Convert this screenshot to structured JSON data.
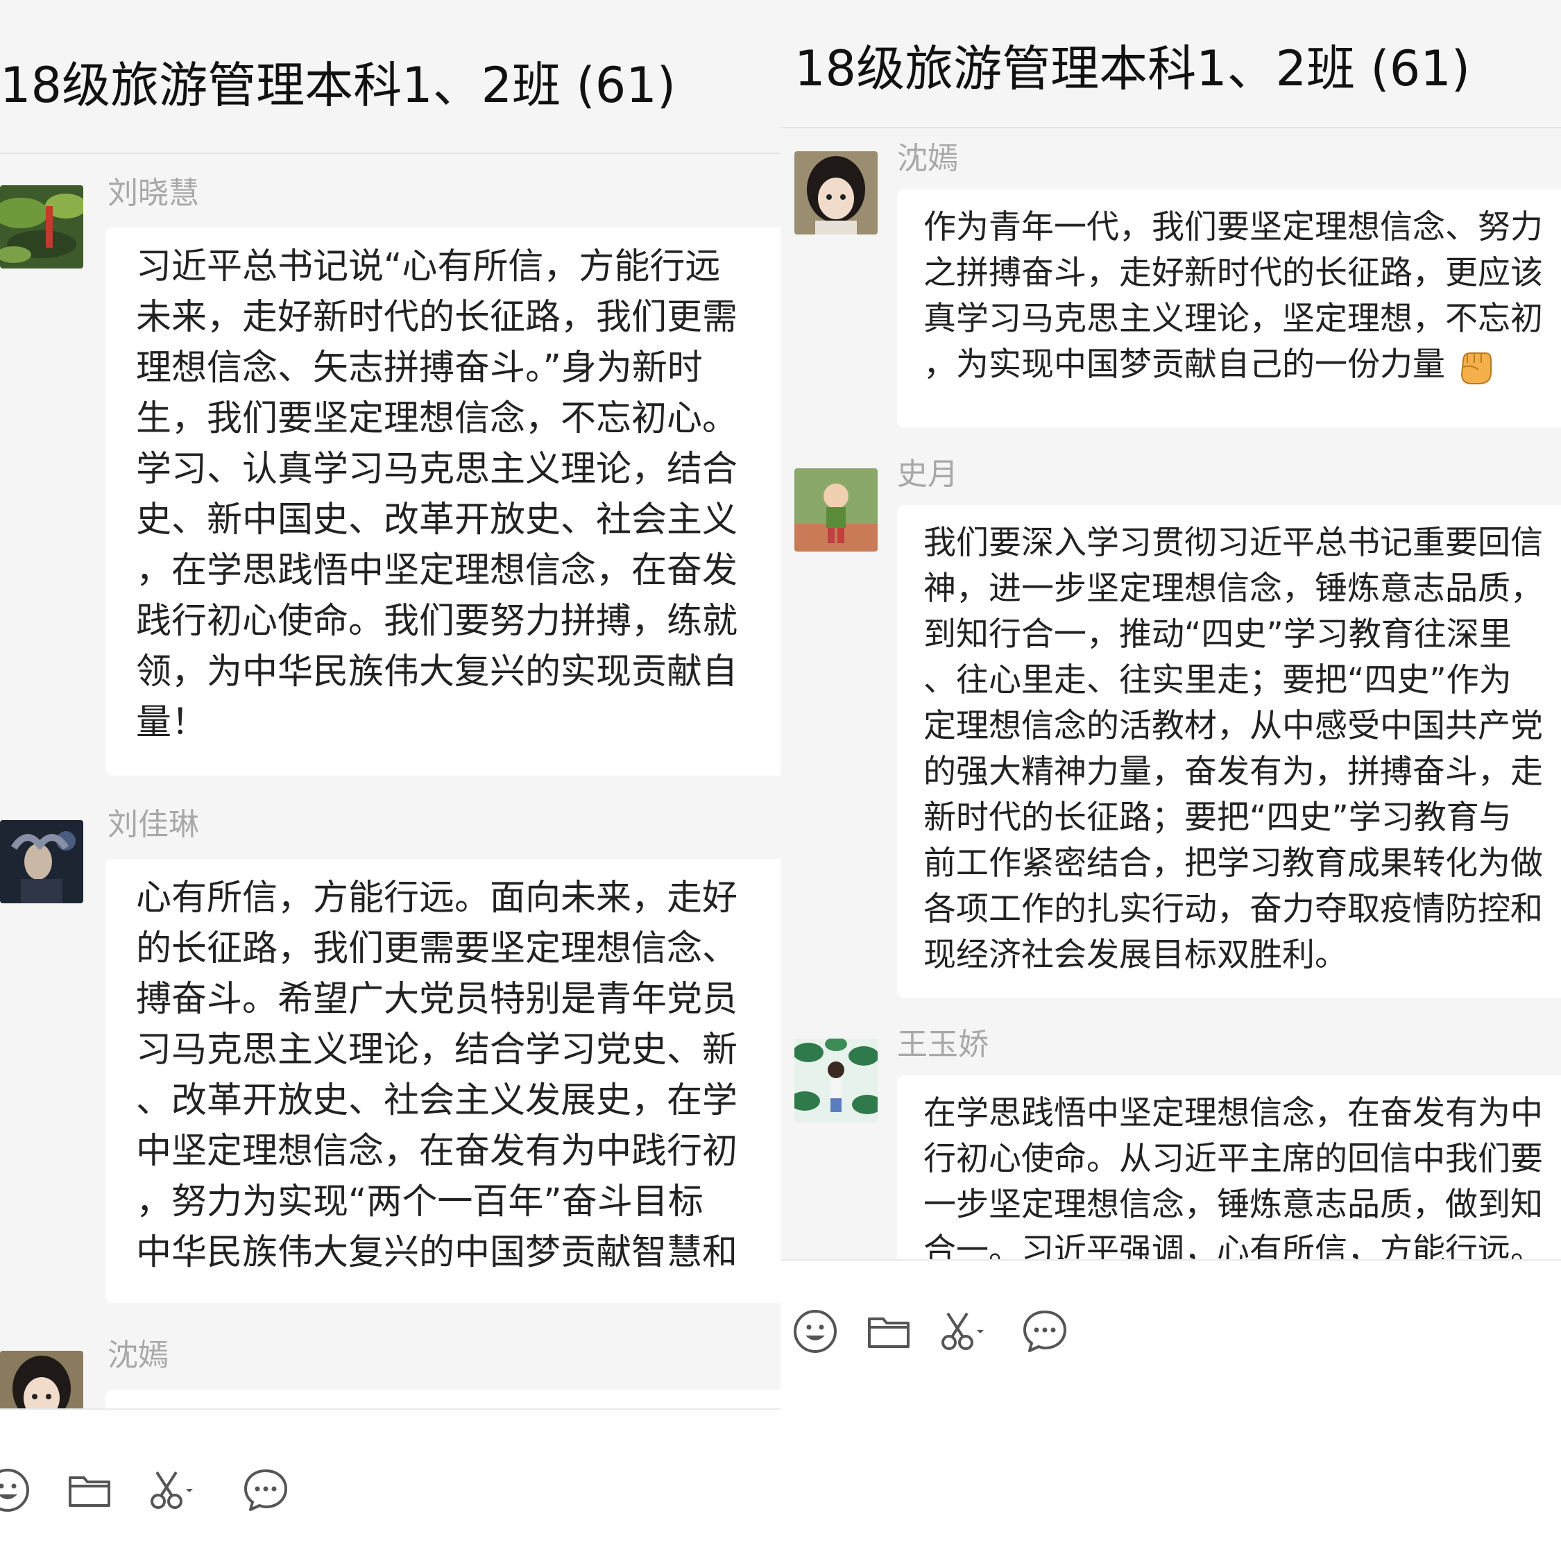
{
  "panels": [
    {
      "title": "18级旅游管理本科1、2班 (61)",
      "messages": [
        {
          "sender": "刘晓慧",
          "text": "习近平总书记说“心有所信，方能行远\n未来，走好新时代的长征路，我们更需\n理想信念、矢志拼搏奋斗。”身为新时\n生，我们要坚定理想信念，不忘初心。\n学习、认真学习马克思主义理论，结合\n史、新中国史、改革开放史、社会主义\n，在学思践悟中坚定理想信念，在奋发\n践行初心使命。我们要努力拼搏，练就\n领，为中华民族伟大复兴的实现贡献自\n量！"
        },
        {
          "sender": "刘佳琳",
          "text": "心有所信，方能行远。面向未来，走好\n的长征路，我们更需要坚定理想信念、\n搏奋斗。希望广大党员特别是青年党员\n习马克思主义理论，结合学习党史、新\n、改革开放史、社会主义发展史，在学\n中坚定理想信念，在奋发有为中践行初\n，努力为实现“两个一百年”奋斗目标\n中华民族伟大复兴的中国梦贡献智慧和"
        },
        {
          "sender": "沈嫣",
          "text": ""
        }
      ]
    },
    {
      "title": "18级旅游管理本科1、2班 (61)",
      "messages": [
        {
          "sender": "沈嫣",
          "text": "作为青年一代，我们要坚定理想信念、努力\n之拼搏奋斗，走好新时代的长征路，更应该\n真学习马克思主义理论，坚定理想，不忘初\n，为实现中国梦贡献自己的一份力量",
          "emoji": "raised-fist-emoji"
        },
        {
          "sender": "史月",
          "text": "我们要深入学习贯彻习近平总书记重要回信\n神，进一步坚定理想信念，锤炼意志品质，\n到知行合一，推动“四史”学习教育往深里\n、往心里走、往实里走；要把“四史”作为\n定理想信念的活教材，从中感受中国共产党\n的强大精神力量，奋发有为，拼搏奋斗，走\n新时代的长征路；要把“四史”学习教育与\n前工作紧密结合，把学习教育成果转化为做\n各项工作的扎实行动，奋力夺取疫情防控和\n现经济社会发展目标双胜利。"
        },
        {
          "sender": "王玉娇",
          "text": "在学思践悟中坚定理想信念，在奋发有为中\n行初心使命。从习近平主席的回信中我们要\n一步坚定理想信念，锤炼意志品质，做到知\n合一。习近平强调，心有所信，方能行远。"
        }
      ]
    }
  ],
  "toolbar": {
    "icons": [
      "emoji-icon",
      "folder-icon",
      "scissors-icon",
      "chat-history-icon"
    ]
  },
  "colors": {
    "chat_background": "#f5f5f5",
    "bubble": "#ffffff",
    "sender_name": "#a8a8a8",
    "message_text": "#222222",
    "icon": "#555555"
  }
}
